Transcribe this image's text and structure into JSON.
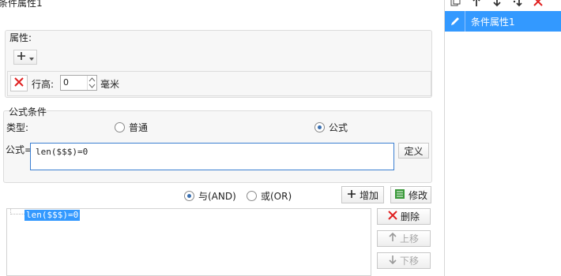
{
  "title": "条件属性1",
  "attr_group": {
    "title": "属性:",
    "row_height_label": "行高:",
    "row_height_value": "0",
    "unit": "毫米"
  },
  "formula_group": {
    "title": "公式条件",
    "type_label": "类型:",
    "radio_normal": "普通",
    "radio_formula": "公式",
    "formula_label": "公式=",
    "formula_value": "len($$$)=0",
    "define_button": "定义"
  },
  "logic": {
    "and_label": "与(AND)",
    "or_label": "或(OR)",
    "add_button": "增加",
    "modify_button": "修改"
  },
  "condition_list": [
    "len($$$)=0"
  ],
  "list_buttons": {
    "delete": "删除",
    "up": "上移",
    "down": "下移"
  },
  "right_list": {
    "items": [
      "条件属性1"
    ]
  },
  "colors": {
    "accent": "#3399ff",
    "delete_red": "#e02020",
    "focus_border": "#3c7fd1"
  }
}
